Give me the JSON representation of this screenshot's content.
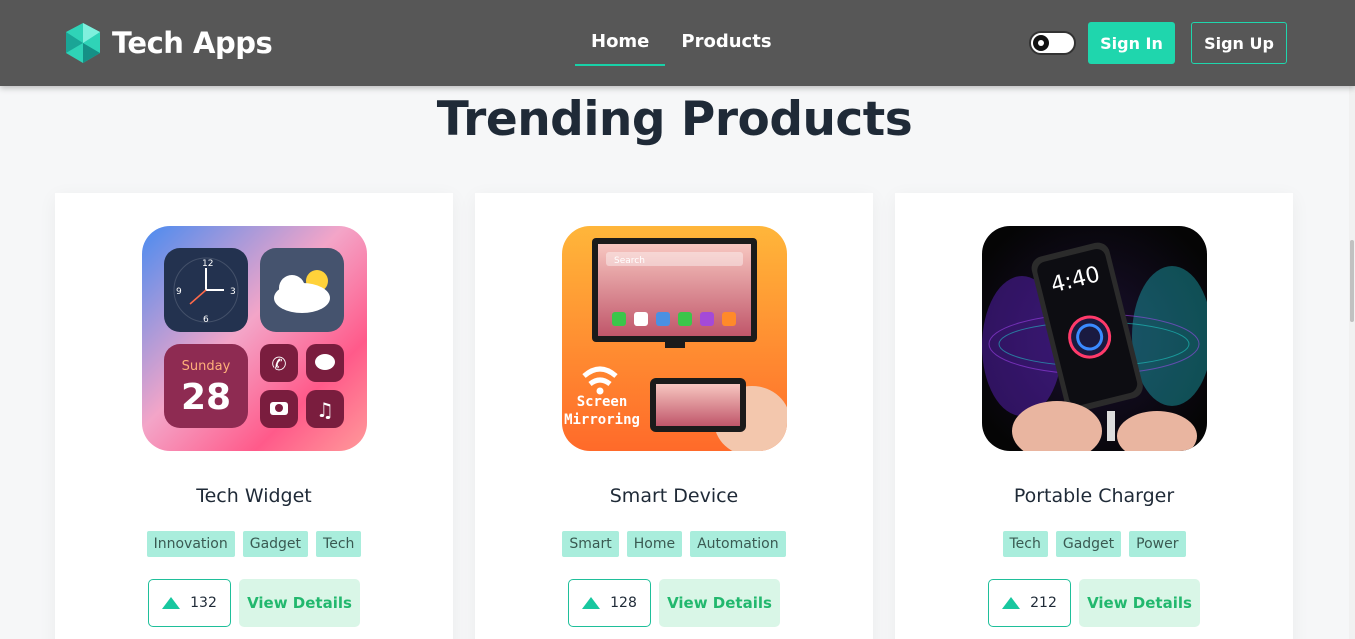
{
  "nav": {
    "brand": "Tech Apps",
    "links": [
      "Home",
      "Products"
    ],
    "sign_in": "Sign In",
    "sign_up": "Sign Up"
  },
  "section_title": "Trending Products",
  "products": [
    {
      "name": "Tech Widget",
      "tags": [
        "Innovation",
        "Gadget",
        "Tech"
      ],
      "votes": "132",
      "details_label": "View Details",
      "image": "widget-app-icon"
    },
    {
      "name": "Smart Device",
      "tags": [
        "Smart",
        "Home",
        "Automation"
      ],
      "votes": "128",
      "details_label": "View Details",
      "image": "screen-mirroring-app-icon"
    },
    {
      "name": "Portable Charger",
      "tags": [
        "Tech",
        "Gadget",
        "Power"
      ],
      "votes": "212",
      "details_label": "View Details",
      "image": "charger-app-icon"
    }
  ],
  "image_text": {
    "widget_day": "Sunday",
    "widget_date": "28",
    "mirror_label_1": "Screen",
    "mirror_label_2": "Mirroring",
    "mirror_search": "Search",
    "charger_time": "4:40"
  },
  "colors": {
    "accent": "#1fd6ad",
    "navbar": "#575757",
    "tag_bg": "#a9eddc",
    "details_bg": "#d9f6e7"
  }
}
